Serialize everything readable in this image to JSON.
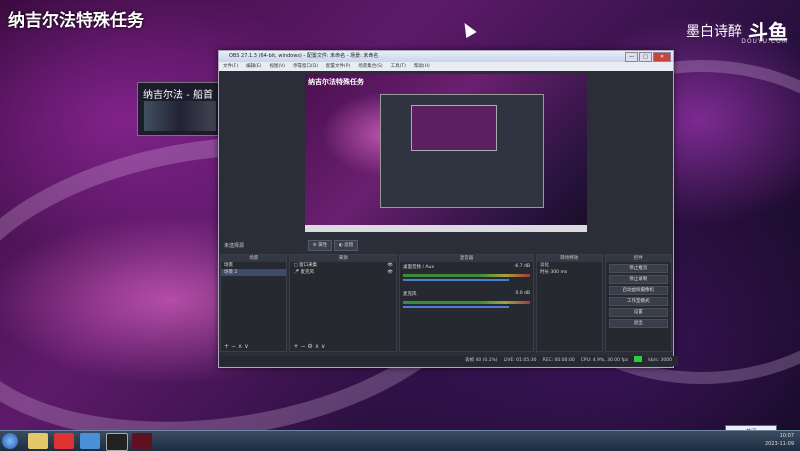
{
  "stream": {
    "title": "纳吉尔法特殊任务",
    "broadcaster": "墨白诗醉",
    "platform_logo": "斗鱼",
    "platform_url": "DOUYU.COM"
  },
  "thumbnail": {
    "title": "纳吉尔法 - 船首"
  },
  "obs": {
    "title": "OBS 27.1.3 (64-bit, windows) - 配置文件: 未命名 - 场景: 未命名",
    "menu": [
      "文件(F)",
      "编辑(E)",
      "视图(V)",
      "停靠窗口(D)",
      "配置文件(P)",
      "场景集合(S)",
      "工具(T)",
      "帮助(H)"
    ],
    "preview_overlay_title": "纳吉尔法特殊任务",
    "mode_label": "未选择源",
    "mode_buttons": [
      "属性",
      "滤镜"
    ],
    "scenes": {
      "header": "场景",
      "items": [
        "场景",
        "场景 2"
      ]
    },
    "sources": {
      "header": "来源",
      "items": [
        "窗口采集",
        "麦克风"
      ]
    },
    "mixer": {
      "header": "混音器",
      "ch1": "桌面音频 / Aux",
      "ch1_db": "-6.7 dB",
      "ch2": "麦克风",
      "ch2_db": "0.0 dB"
    },
    "transitions": {
      "header": "转场特效",
      "type": "淡化",
      "duration_label": "时长",
      "duration": "300 ms"
    },
    "controls": {
      "header": "控件",
      "buttons": [
        "停止推流",
        "停止录制",
        "启动虚拟摄像机",
        "工作室模式",
        "设置",
        "退出"
      ]
    },
    "status": {
      "dropped": "丢帧 40 (0.1%)",
      "live": "LIVE: 01:05:30",
      "rec": "REC: 00:00:00",
      "cpu": "CPU: 4.9%, 30.00 fps",
      "bitrate": "kb/s: 3000"
    }
  },
  "tooltip": "关闭",
  "tray": {
    "time": "10:07",
    "date": "2023-11-09"
  }
}
